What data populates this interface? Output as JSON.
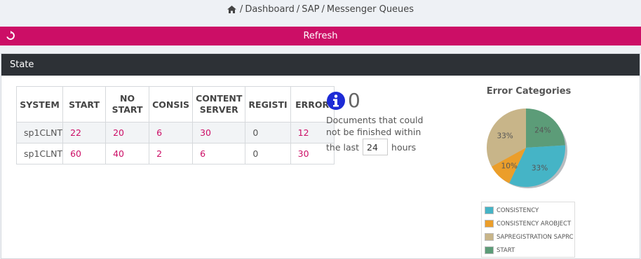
{
  "breadcrumb": {
    "items": [
      "Dashboard",
      "SAP",
      "Messenger Queues"
    ],
    "separator": "/"
  },
  "refresh": {
    "label": "Refresh"
  },
  "panel": {
    "title": "State"
  },
  "table": {
    "headers": [
      "SYSTEM",
      "START",
      "NO START",
      "CONSIS",
      "CONTENT SERVER",
      "REGISTI",
      "ERROR"
    ],
    "rows": [
      [
        "sp1CLNT",
        "22",
        "20",
        "6",
        "30",
        "0",
        "12"
      ],
      [
        "sp1CLNT",
        "60",
        "40",
        "2",
        "6",
        "0",
        "30"
      ]
    ]
  },
  "info": {
    "count": "0",
    "text": "Documents that could not be finished within",
    "prefix": "the last",
    "hours_value": "24",
    "suffix": "hours"
  },
  "chart_data": {
    "type": "pie",
    "title": "Error Categories",
    "labels": [
      "CONSISTENCY",
      "CONSISTENCY AROBJECT",
      "SAPREGISTRATION SAPRC",
      "START"
    ],
    "values": [
      33,
      10,
      33,
      24
    ],
    "colors": [
      "#45b4c6",
      "#eb9e2a",
      "#c8b589",
      "#5c9c78"
    ],
    "data_labels": [
      "33%",
      "10%",
      "33%",
      "24%"
    ],
    "legend_position": "bottom"
  }
}
